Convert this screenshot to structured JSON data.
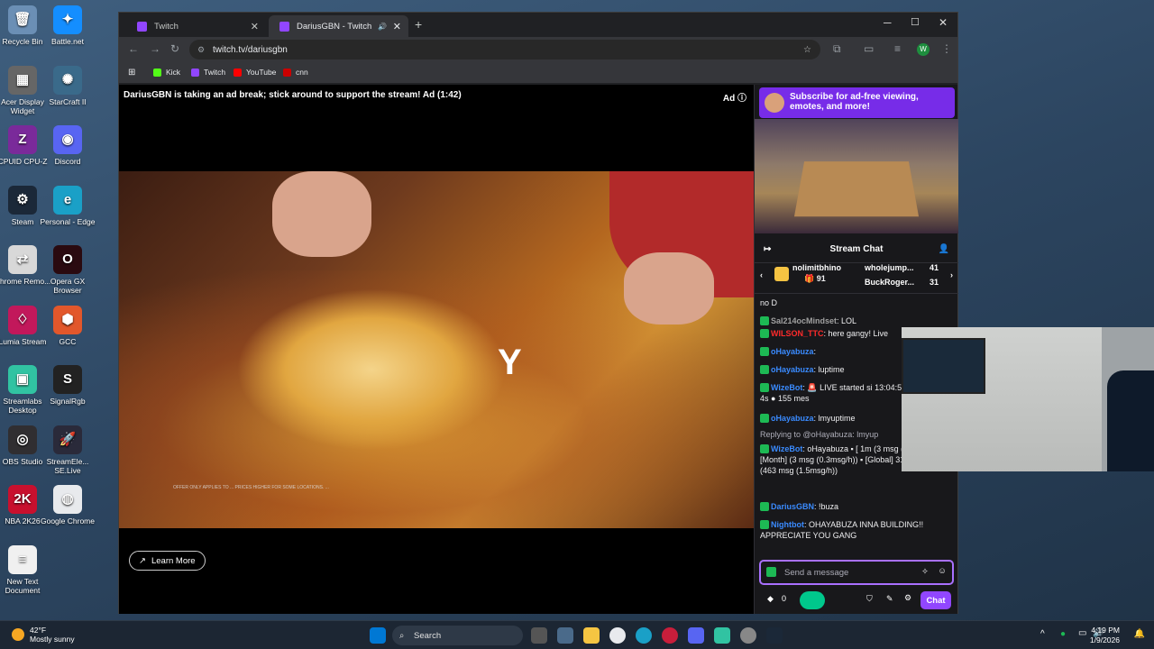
{
  "desktop": {
    "icons": [
      {
        "label": "Recycle Bin",
        "glyph": "🗑",
        "color": "#6b8fb5"
      },
      {
        "label": "Battle.net",
        "glyph": "✦",
        "color": "#148eff"
      },
      {
        "label": "Acer Display Widget",
        "glyph": "▦",
        "color": "#666"
      },
      {
        "label": "StarCraft II",
        "glyph": "✺",
        "color": "#3a6a8a"
      },
      {
        "label": "CPUID CPU-Z",
        "glyph": "Z",
        "color": "#7a2a9a"
      },
      {
        "label": "Discord",
        "glyph": "◉",
        "color": "#5865f2"
      },
      {
        "label": "Steam",
        "glyph": "⚙",
        "color": "#1b2838"
      },
      {
        "label": "Personal - Edge",
        "glyph": "e",
        "color": "#1aa0c7"
      },
      {
        "label": "Chrome Remo...",
        "glyph": "⇄",
        "color": "#d8d8d8"
      },
      {
        "label": "Opera GX Browser",
        "glyph": "O",
        "color": "#2a0a10"
      },
      {
        "label": "Lumia Stream",
        "glyph": "♢",
        "color": "#c2185b"
      },
      {
        "label": "GCC",
        "glyph": "⬢",
        "color": "#e2572b"
      },
      {
        "label": "Streamlabs Desktop",
        "glyph": "▣",
        "color": "#31c3a2"
      },
      {
        "label": "SignalRgb",
        "glyph": "S",
        "color": "#222"
      },
      {
        "label": "OBS Studio",
        "glyph": "◎",
        "color": "#302e31"
      },
      {
        "label": "StreamEle... SE.Live",
        "glyph": "🚀",
        "color": "#2a2a3a"
      },
      {
        "label": "NBA 2K26",
        "glyph": "2K",
        "color": "#c8102e"
      },
      {
        "label": "Google Chrome",
        "glyph": "◍",
        "color": "#e8eaed"
      },
      {
        "label": "New Text Document",
        "glyph": "≡",
        "color": "#f0f0f0"
      }
    ]
  },
  "browser": {
    "tabs": [
      {
        "title": "Twitch",
        "close": "✕"
      },
      {
        "title": "DariusGBN - Twitch",
        "close": "✕",
        "audio": "🔊"
      }
    ],
    "new_tab": "+",
    "url": "twitch.tv/dariusgbn",
    "bookmarks": [
      {
        "label": "Kick",
        "color": "#53fc18"
      },
      {
        "label": "Twitch",
        "color": "#9146ff"
      },
      {
        "label": "YouTube",
        "color": "#ff0000"
      },
      {
        "label": "cnn",
        "color": "#cc0000"
      }
    ]
  },
  "player": {
    "ad_message": "DariusGBN is taking an ad break; stick around to support the stream! Ad (1:42)",
    "ad_badge": "Ad",
    "overlay_letter": "Y",
    "fineprint": "OFFER ONLY APPLIES TO ... PRICES HIGHER FOR SOME LOCATIONS. ...",
    "learn_more": "Learn More"
  },
  "chat": {
    "sub_banner": "Subscribe for ad-free viewing, emotes, and more!",
    "title": "Stream Chat",
    "gifters": [
      {
        "name": "nolimitbhino",
        "count": "91"
      },
      {
        "name": "wholejump...",
        "count": "41"
      },
      {
        "name": "BuckRoger...",
        "count": "31"
      }
    ],
    "messages": [
      {
        "user": "",
        "color": "#efeff1",
        "text": "no D"
      },
      {
        "user": "Sal214ocMindset",
        "color": "#a0a0a0",
        "text": ": LOL"
      },
      {
        "user": "WILSON_TTC",
        "color": "#ff2b2b",
        "text": ": here gangy! Live"
      },
      {
        "user": "oHayabuza",
        "color": "#3a8bff",
        "text": ":"
      },
      {
        "user": "oHayabuza",
        "color": "#3a8bff",
        "text": ": luptime"
      },
      {
        "user": "WizeBot",
        "color": "#3a8bff",
        "text": ": 🚨 LIVE started si 13:04:58 ◆ 4h 10m 4s ● 155 mes"
      },
      {
        "user": "oHayabuza",
        "color": "#3a8bff",
        "text": ": lmyuptime"
      },
      {
        "user": "",
        "color": "#adadb8",
        "text": "Replying to @oHayabuza: lmyup"
      },
      {
        "user": "WizeBot",
        "color": "#3a8bff",
        "text": ": oHayabuza ▪ [ 1m (3 msg (2.9msg/h)) ▪ [Month] (3 msg (0.3msg/h)) ▪ [Global] 316h 23m (463 msg (1.5msg/h))"
      },
      {
        "user": "DariusGBN",
        "color": "#3a8bff",
        "text": ": !buza"
      },
      {
        "user": "Nightbot",
        "color": "#3a8bff",
        "text": ": OHAYABUZA INNA BUILDING!! APPRECIATE YOU GANG"
      }
    ],
    "input_placeholder": "Send a message",
    "points": "0",
    "chat_button": "Chat"
  },
  "taskbar": {
    "weather_temp": "42°F",
    "weather_desc": "Mostly sunny",
    "search": "Search",
    "time": "4:19 PM",
    "date": "1/9/2026"
  }
}
